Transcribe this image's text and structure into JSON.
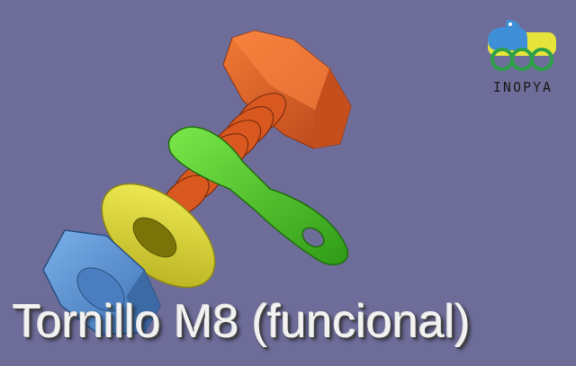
{
  "title": "Tornillo M8 (funcional)",
  "logo": {
    "text": "INOPYA"
  },
  "colors": {
    "background": "#6e6d99",
    "bolt": "#e2601e",
    "bracket": "#5fd42a",
    "washer": "#e8e23a",
    "nut": "#5b95d6"
  },
  "parts": [
    "bolt-icon",
    "bracket-icon",
    "washer-icon",
    "nut-icon"
  ]
}
